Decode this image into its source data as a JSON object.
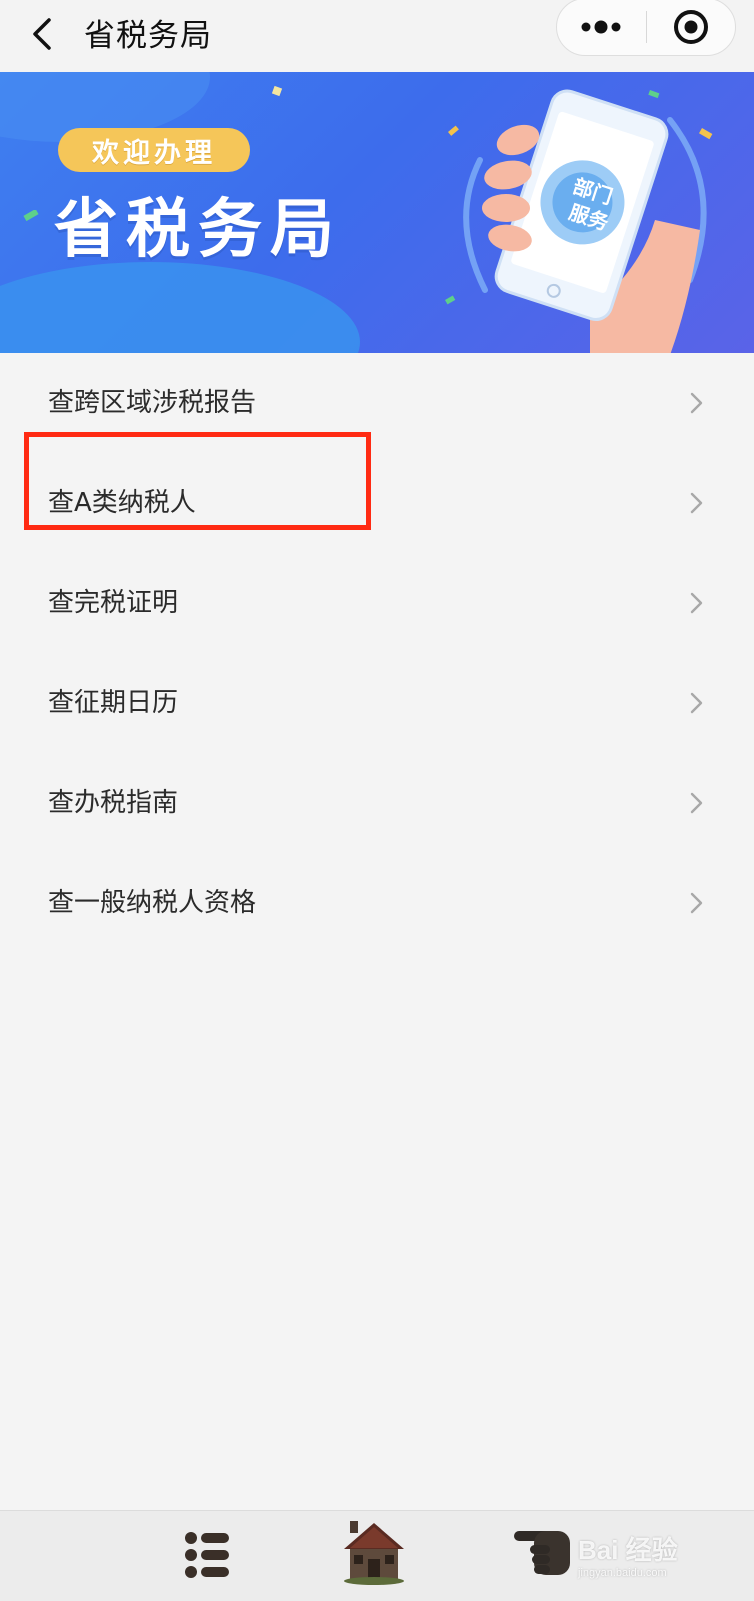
{
  "titlebar": {
    "title": "省税务局"
  },
  "banner": {
    "welcome": "欢迎办理",
    "title": "省税务局",
    "phone_badge_line1": "部门",
    "phone_badge_line2": "服务"
  },
  "menu": {
    "items": [
      {
        "label": "查跨区域涉税报告"
      },
      {
        "label": "查A类纳税人"
      },
      {
        "label": "查完税证明"
      },
      {
        "label": "查征期日历"
      },
      {
        "label": "查办税指南"
      },
      {
        "label": "查一般纳税人资格"
      }
    ],
    "highlighted_index": 1,
    "highlight_color": "#ff2a12"
  },
  "bottombar": {
    "icons": [
      "list-icon",
      "home-icon",
      "pointing-hand-icon"
    ]
  },
  "watermark": {
    "text": "Bai 经验",
    "sub": "jingyan.baidu.com"
  },
  "colors": {
    "banner_blue": "#3d6cec",
    "pill_yellow": "#f5c659",
    "background": "#f4f4f4"
  }
}
